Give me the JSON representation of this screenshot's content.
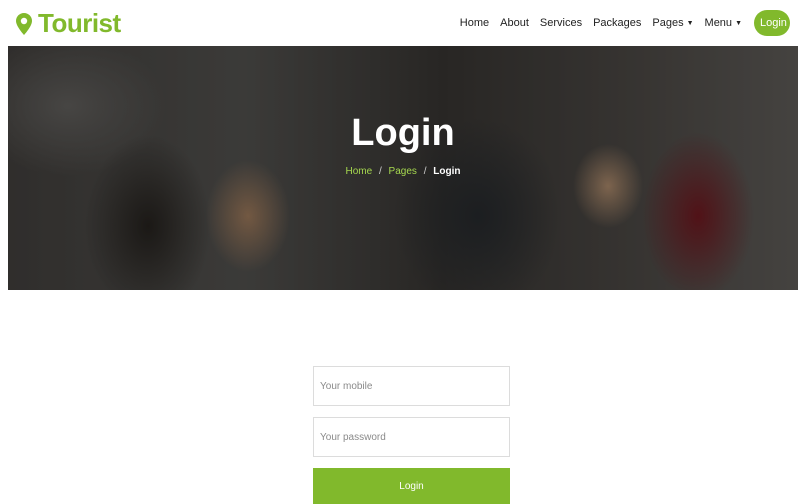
{
  "brand": {
    "name": "Tourist",
    "icon": "map-pin-icon",
    "color": "#81b92c"
  },
  "nav": {
    "items": [
      "Home",
      "About",
      "Services",
      "Packages"
    ],
    "pages_label": "Pages",
    "menu_label": "Menu",
    "login_label": "Login"
  },
  "hero": {
    "title": "Login",
    "breadcrumb": {
      "home": "Home",
      "pages": "Pages",
      "current": "Login",
      "separator": "/"
    }
  },
  "form": {
    "mobile_placeholder": "Your mobile",
    "password_placeholder": "Your password",
    "submit_label": "Login"
  },
  "colors": {
    "accent": "#81b92c"
  }
}
